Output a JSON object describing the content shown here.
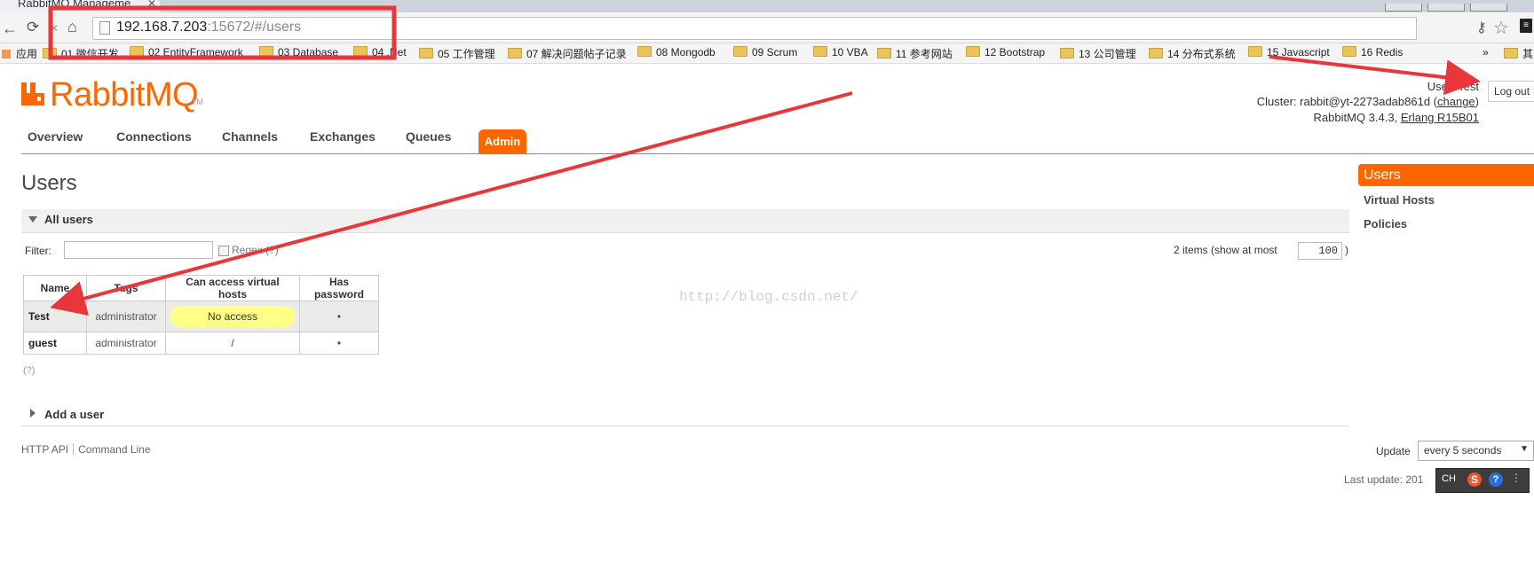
{
  "browser": {
    "tab_title": "RabbitMQ Manageme...",
    "url_host": "192.168.7.203",
    "url_rest": ":15672/#/users",
    "bookmarks": [
      "应用",
      "01 微信开发",
      "02 EntityFramework",
      "03 Database",
      "04 .Net",
      "05 工作管理",
      "07 解决问题帖子记录",
      "08 Mongodb",
      "09 Scrum",
      "10 VBA",
      "11 参考网站",
      "12 Bootstrap",
      "13 公司管理",
      "14 分布式系统",
      "15 Javascript",
      "16 Redis",
      "»",
      "其"
    ]
  },
  "header": {
    "logo_text": "RabbitMQ",
    "user_line": "User: Test",
    "cluster_prefix": "Cluster: rabbit@yt-2273adab861d (",
    "cluster_change": "change",
    "cluster_suffix": ")",
    "version_line": "RabbitMQ 3.4.3,",
    "erlang": "Erlang R15B01",
    "logout": "Log out"
  },
  "nav": {
    "tabs": [
      "Overview",
      "Connections",
      "Channels",
      "Exchanges",
      "Queues",
      "Admin"
    ],
    "active": "Admin"
  },
  "page": {
    "title": "Users"
  },
  "sidenav": {
    "items": [
      "Users",
      "Virtual Hosts",
      "Policies"
    ],
    "active": "Users"
  },
  "all_users": {
    "section_title": "All users",
    "filter_label": "Filter:",
    "filter_value": "",
    "regex_label": "Regex (?)",
    "count_text": "2 items (show at most",
    "page_size": "100",
    "count_close": ")",
    "columns": [
      "Name",
      "Tags",
      "Can access virtual hosts",
      "Has password"
    ],
    "rows": [
      {
        "name": "Test",
        "tags": "administrator",
        "vhosts": "No access",
        "password": "•"
      },
      {
        "name": "guest",
        "tags": "administrator",
        "vhosts": "/",
        "password": "•"
      }
    ],
    "help": "(?)"
  },
  "add_user": {
    "section_title": "Add a user"
  },
  "footer": {
    "http_api": "HTTP API",
    "command_line": "Command Line",
    "update_label": "Update",
    "update_value": "every 5 seconds",
    "last_update": "Last update: 201"
  },
  "watermark": "http://blog.csdn.net/",
  "colors": {
    "accent": "#ff6600",
    "annotation": "#e8363a",
    "pill": "#ffff88"
  }
}
